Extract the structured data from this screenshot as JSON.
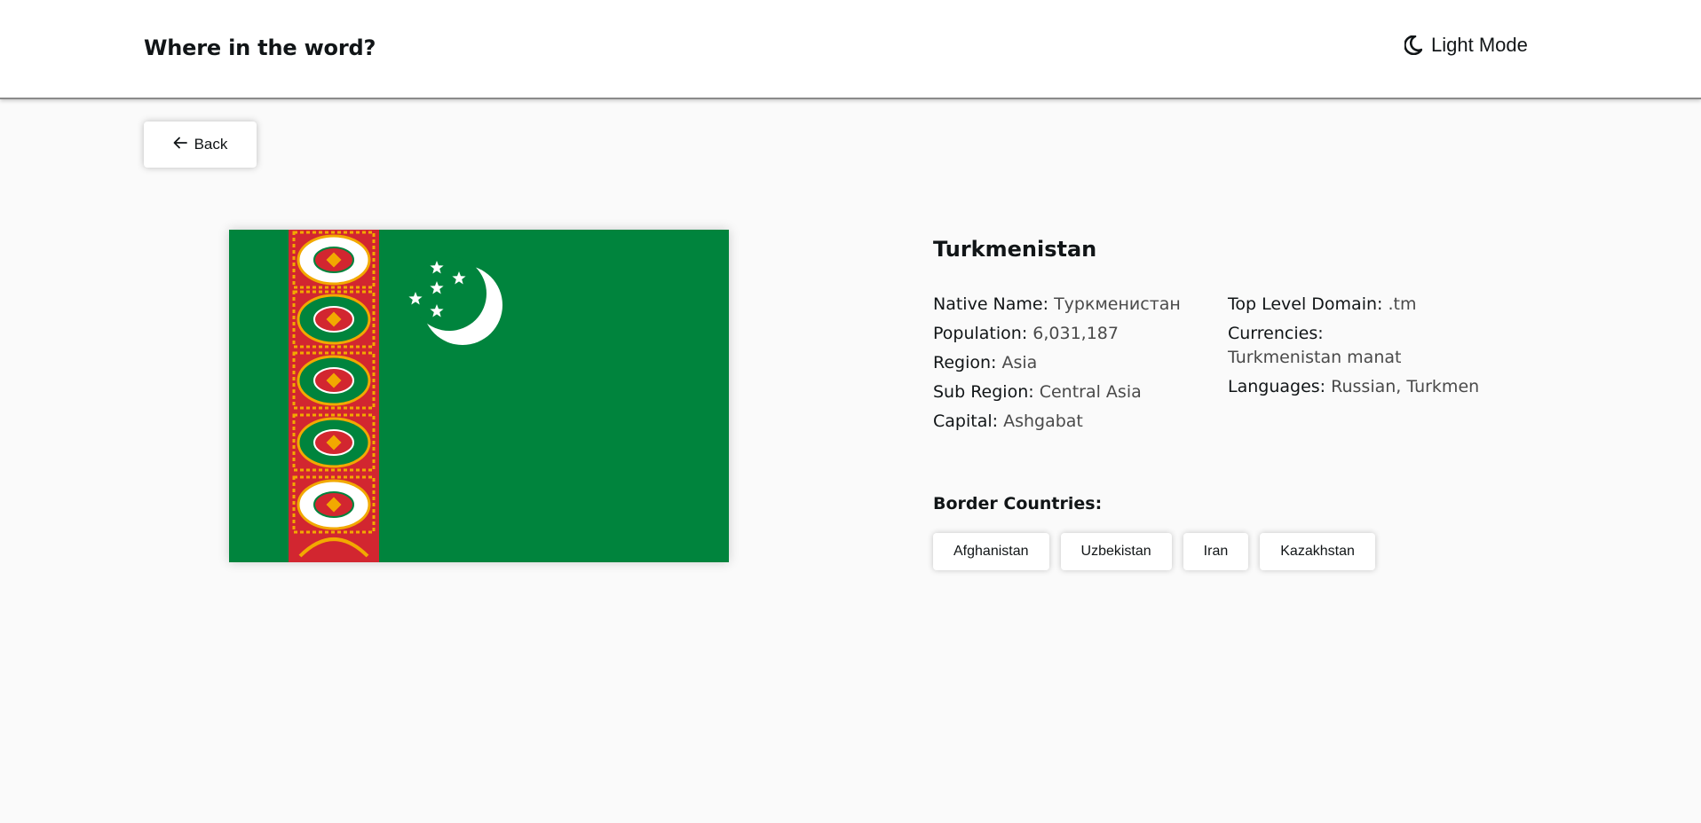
{
  "header": {
    "title": "Where in the word?",
    "mode_label": "Light Mode",
    "mode_icon": "moon-icon"
  },
  "back_button": {
    "label": "Back",
    "icon": "arrow-left-icon"
  },
  "country": {
    "name": "Turkmenistan",
    "flag_colors": {
      "green": "#00843d",
      "red": "#d22630",
      "white": "#ffffff",
      "gold": "#f2a900"
    },
    "details_left": [
      {
        "key": "Native Name:",
        "value": "Туркменистан"
      },
      {
        "key": "Population:",
        "value": "6,031,187"
      },
      {
        "key": "Region:",
        "value": "Asia"
      },
      {
        "key": "Sub Region:",
        "value": "Central Asia"
      },
      {
        "key": "Capital:",
        "value": "Ashgabat"
      }
    ],
    "details_right": [
      {
        "key": "Top Level Domain:",
        "value": ".tm"
      },
      {
        "key": "Currencies:",
        "value": "Turkmenistan manat"
      },
      {
        "key": "Languages:",
        "value": "Russian, Turkmen"
      }
    ],
    "border_label": "Border Countries:",
    "border_countries": [
      "Afghanistan",
      "Uzbekistan",
      "Iran",
      "Kazakhstan"
    ]
  }
}
